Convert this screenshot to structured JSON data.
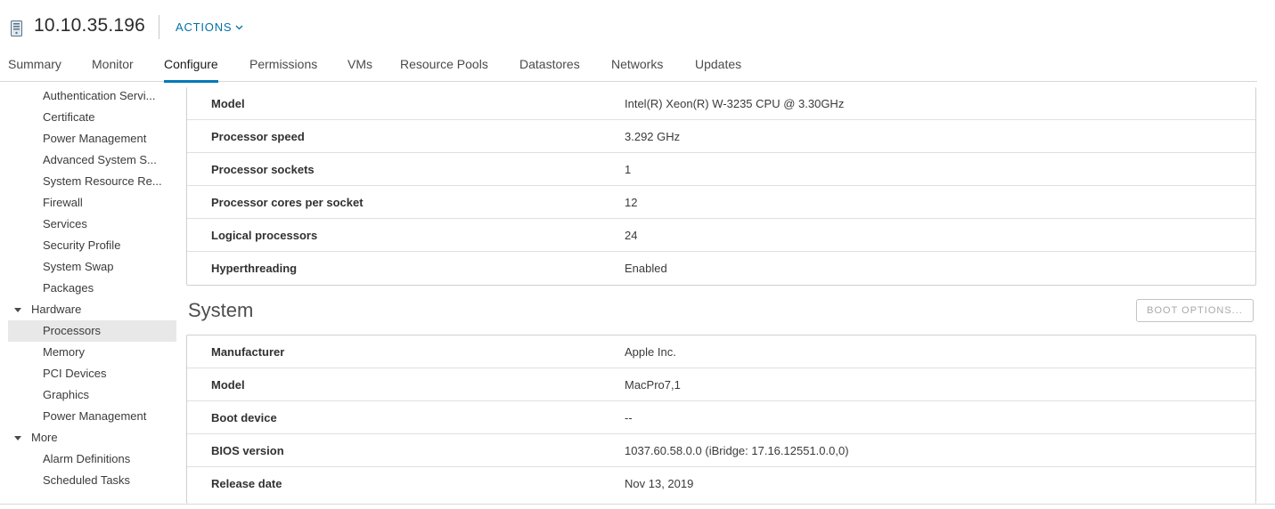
{
  "header": {
    "host_title": "10.10.35.196",
    "actions_label": "ACTIONS",
    "host_icon": "host-server-icon",
    "accent_color": "#0072a3"
  },
  "tabs": [
    {
      "label": "Summary",
      "active": false
    },
    {
      "label": "Monitor",
      "active": false
    },
    {
      "label": "Configure",
      "active": true
    },
    {
      "label": "Permissions",
      "active": false
    },
    {
      "label": "VMs",
      "active": false
    },
    {
      "label": "Resource Pools",
      "active": false
    },
    {
      "label": "Datastores",
      "active": false
    },
    {
      "label": "Networks",
      "active": false
    },
    {
      "label": "Updates",
      "active": false
    }
  ],
  "sidebar": {
    "items": [
      {
        "label": "Authentication Servi..."
      },
      {
        "label": "Certificate"
      },
      {
        "label": "Power Management"
      },
      {
        "label": "Advanced System S..."
      },
      {
        "label": "System Resource Re..."
      },
      {
        "label": "Firewall"
      },
      {
        "label": "Services"
      },
      {
        "label": "Security Profile"
      },
      {
        "label": "System Swap"
      },
      {
        "label": "Packages"
      },
      {
        "label": "Hardware",
        "group": true
      },
      {
        "label": "Processors",
        "selected": true
      },
      {
        "label": "Memory"
      },
      {
        "label": "PCI Devices"
      },
      {
        "label": "Graphics"
      },
      {
        "label": "Power Management"
      },
      {
        "label": "More",
        "group": true
      },
      {
        "label": "Alarm Definitions"
      },
      {
        "label": "Scheduled Tasks"
      }
    ]
  },
  "processor": {
    "rows": [
      {
        "key": "Model",
        "value": "Intel(R) Xeon(R) W-3235 CPU @ 3.30GHz"
      },
      {
        "key": "Processor speed",
        "value": "3.292 GHz"
      },
      {
        "key": "Processor sockets",
        "value": "1"
      },
      {
        "key": "Processor cores per socket",
        "value": "12"
      },
      {
        "key": "Logical processors",
        "value": "24"
      },
      {
        "key": "Hyperthreading",
        "value": "Enabled"
      }
    ]
  },
  "system": {
    "title": "System",
    "boot_options_label": "BOOT OPTIONS...",
    "rows": [
      {
        "key": "Manufacturer",
        "value": "Apple Inc."
      },
      {
        "key": "Model",
        "value": "MacPro7,1"
      },
      {
        "key": "Boot device",
        "value": "--"
      },
      {
        "key": "BIOS version",
        "value": "1037.60.58.0.0 (iBridge: 17.16.12551.0.0,0)"
      },
      {
        "key": "Release date",
        "value": "Nov 13, 2019"
      }
    ]
  }
}
